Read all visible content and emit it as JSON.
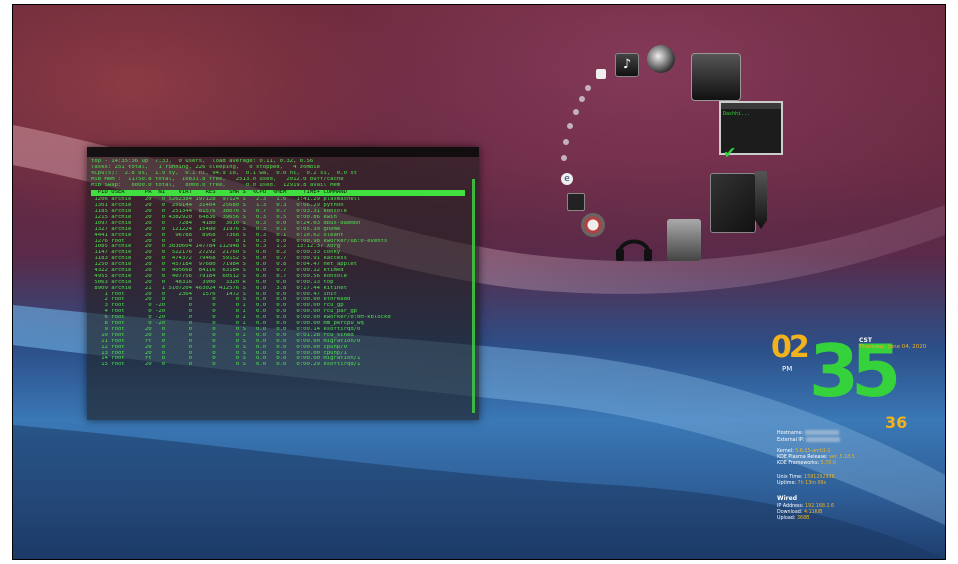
{
  "terminal": {
    "summary": [
      "top - 14:35:36 up  7:33,  0 users,  load average: 0.11, 0.32, 0.56",
      "Tasks: 251 total,   1 running, 226 sleeping,   0 stopped,   4 zombie",
      "%Cpu(s):  2.8 us,  1.9 sy,  0.1 ni, 94.9 id,  0.1 wa,  0.0 hi,  0.2 si,  0.0 st",
      "MiB Mem :  11750.8 total,  10831.8 free,   2513.0 used,   2012.0 buff/cache",
      "MiB Swap:   8000.0 total,   8000.0 free,      0.0 used.  12919.8 avail Mem"
    ],
    "header": "  PID USER      PR  NI    VIRT    RES    SHR S  %CPU  %MEM     TIME+ COMMAND",
    "rows": [
      " 1206 archie    20   0 5262384 197128  97124 S   2.3   1.6   1:41.29 plasmashell",
      " 1301 archie    20   0  259144  31404  25680 S   1.3   0.3   0:06.29 python",
      " 1185 archie    20   0  251344  81576  38076 S   0.7   0.7   0:03.31 konsole",
      " 1215 archie    20   0 4382920  64836  39656 S   0.3   0.5   0:00.86 kwin",
      " 1097 archie    20   0    7284   4180   3016 S   0.3   0.0   0:24.03 dbus-daemon",
      " 1327 archie    20   0  121224  15480  11976 S   0.3   0.1   0:05.39 gnome",
      " 4441 archie    20   0   96788   8968   7368 S   0.3   0.1   0:10.62 oleant",
      " 1276 root      20   0       0      0      0 I   0.3   0.0   0:00.98 kworker/u8:0-events",
      " 1085 archie    20   0 3030604 147784 112948 S   0.3   1.2   13:12.37 Xorg",
      " 1147 archie    20   0  522176  27292  21760 S   0.0   0.2   0:00.33 conky",
      " 1183 archie    20   0  474372  79468  59152 S   0.0   0.7   0:00.91 kaccess",
      " 1250 archie    20   0  457184  97680  71984 S   0.0   0.8   0:04.47 net_applet",
      " 4322 archie    20   0  405668  84116  63184 S   0.0   0.7   0:00.12 ktimed",
      " 4955 archie    20   0  407756  79184  60512 S   0.0   0.7   0:00.56 konsole",
      " 5063 archie    20   0   48316   3900   3320 R   0.0   0.0   0:00.13 top",
      " 8909 archie    21   1 5107204 463024 412576 S   0.0   3.8   0:17.44 kitinet",
      "    1 root      20   0    2364   1576   1472 S   0.0   0.0   0:00.47 init",
      "    2 root      20   0       0      0      0 S   0.0   0.0   0:00.00 kthreadd",
      "    3 root       0 -20       0      0      0 I   0.0   0.0   0:00.00 rcu_gp",
      "    4 root       0 -20       0      0      0 I   0.0   0.0   0:00.00 rcu_par_gp",
      "    6 root       0 -20       0      0      0 I   0.0   0.0   0:00.00 kworker/0:0H-kblockd",
      "    8 root       0 -20       0      0      0 I   0.0   0.0   0:00.00 mm_percpu_wq",
      "    9 root      20   0       0      0      0 S   0.0   0.0   0:00.14 ksoftirqd/0",
      "   10 root      20   0       0      0      0 I   0.0   0.0   0:01.28 rcu_sched",
      "   11 root      rt   0       0      0      0 S   0.0   0.0   0:00.00 migration/0",
      "   12 root      20   0       0      0      0 S   0.0   0.0   0:00.00 cpuhp/0",
      "   13 root      20   0       0      0      0 S   0.0   0.0   0:00.00 cpuhp/1",
      "   14 root      rt   0       0      0      0 S   0.0   0.0   0:00.00 migration/1",
      "   15 root      20   0       0      0      0 S   0.0   0.0   0:00.29 ksoftirqd/1"
    ]
  },
  "launcher": {
    "terminal_window_text": "Dashhi..."
  },
  "clock": {
    "hour": "02",
    "minute": "35",
    "second": "36",
    "ampm": "PM",
    "timezone": "CST",
    "date": "Thursday, June 04, 2020"
  },
  "system_info": {
    "hostname_label": "Hostname:",
    "external_ip_label": "External IP:",
    "kernel_label": "Kernel:",
    "kernel_value": "5.6.15-arch1-1",
    "plasma_label": "KDE Plasma Release:",
    "plasma_value": "ver. 5.18.5",
    "frameworks_label": "KDE Frameworks:",
    "frameworks_value": "5.70.0",
    "unix_time_label": "Unix Time:",
    "unix_time_value": "1591292936",
    "uptime_label": "Uptime:",
    "uptime_value": "7h 13m 09s",
    "wired_heading": "Wired",
    "ip_label": "IP Address:",
    "ip_value": "192.168.1.6",
    "download_label": "Download:",
    "download_value": "4.11KiB",
    "upload_label": "Upload:",
    "upload_value": "368B"
  },
  "colors": {
    "accent_green": "#35d23c",
    "accent_orange": "#f2b21b",
    "terminal_text": "#4fe04f"
  }
}
